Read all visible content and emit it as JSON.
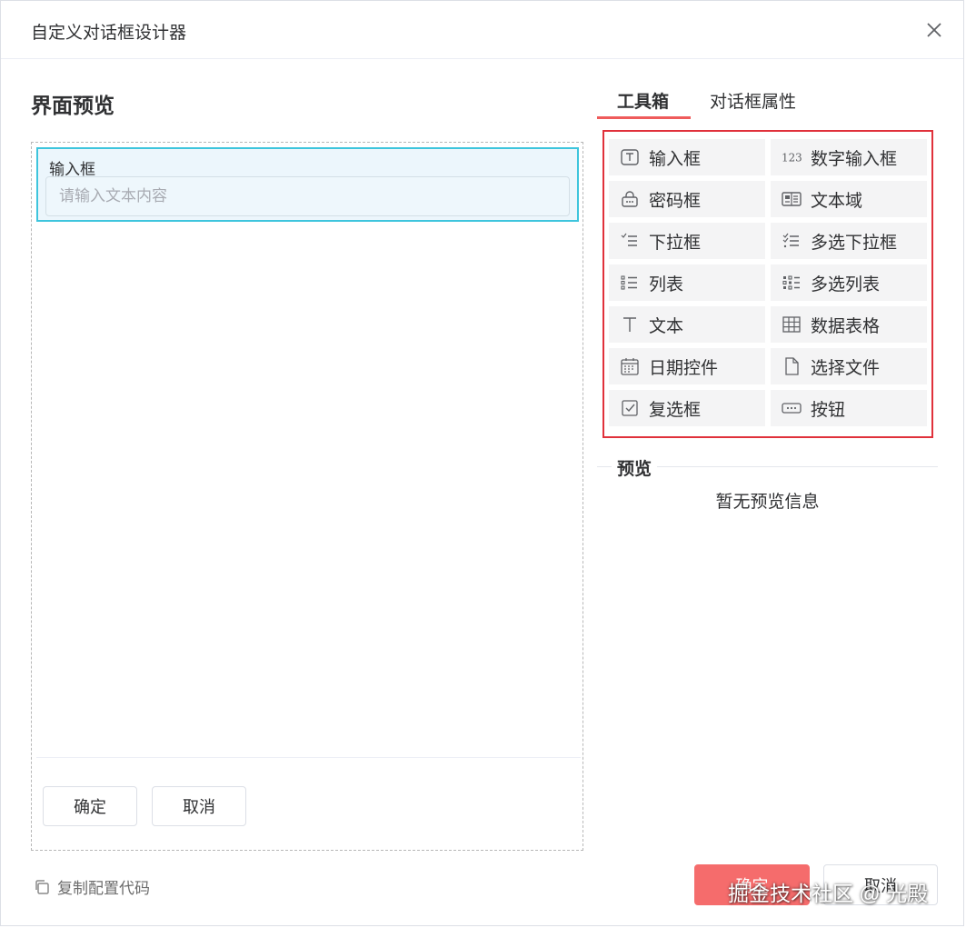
{
  "dialog": {
    "title": "自定义对话框设计器",
    "close_icon": "close-icon"
  },
  "left": {
    "title": "界面预览",
    "field": {
      "label": "输入框",
      "placeholder": "请输入文本内容"
    },
    "confirm_label": "确定",
    "cancel_label": "取消",
    "copy_config_label": "复制配置代码"
  },
  "tabs": {
    "toolbox": "工具箱",
    "dialog_props": "对话框属性"
  },
  "tools": [
    {
      "label": "输入框",
      "icon": "text-input-icon"
    },
    {
      "label": "数字输入框",
      "icon": "number-123-icon"
    },
    {
      "label": "密码框",
      "icon": "password-icon"
    },
    {
      "label": "文本域",
      "icon": "textarea-icon"
    },
    {
      "label": "下拉框",
      "icon": "dropdown-icon"
    },
    {
      "label": "多选下拉框",
      "icon": "multi-dropdown-icon"
    },
    {
      "label": "列表",
      "icon": "list-icon"
    },
    {
      "label": "多选列表",
      "icon": "multi-list-icon"
    },
    {
      "label": "文本",
      "icon": "text-icon"
    },
    {
      "label": "数据表格",
      "icon": "table-icon"
    },
    {
      "label": "日期控件",
      "icon": "calendar-icon"
    },
    {
      "label": "选择文件",
      "icon": "file-icon"
    },
    {
      "label": "复选框",
      "icon": "checkbox-icon"
    },
    {
      "label": "按钮",
      "icon": "button-icon"
    }
  ],
  "preview": {
    "title": "预览",
    "empty_text": "暂无预览信息"
  },
  "footer": {
    "ok_label": "确定",
    "cancel_label": "取消",
    "watermark": "掘金技术社区 @ 光殿"
  },
  "colors": {
    "accent_red": "#f56c6c",
    "highlight_border": "#e0313b",
    "selected_field_border": "#3ec5dd"
  }
}
